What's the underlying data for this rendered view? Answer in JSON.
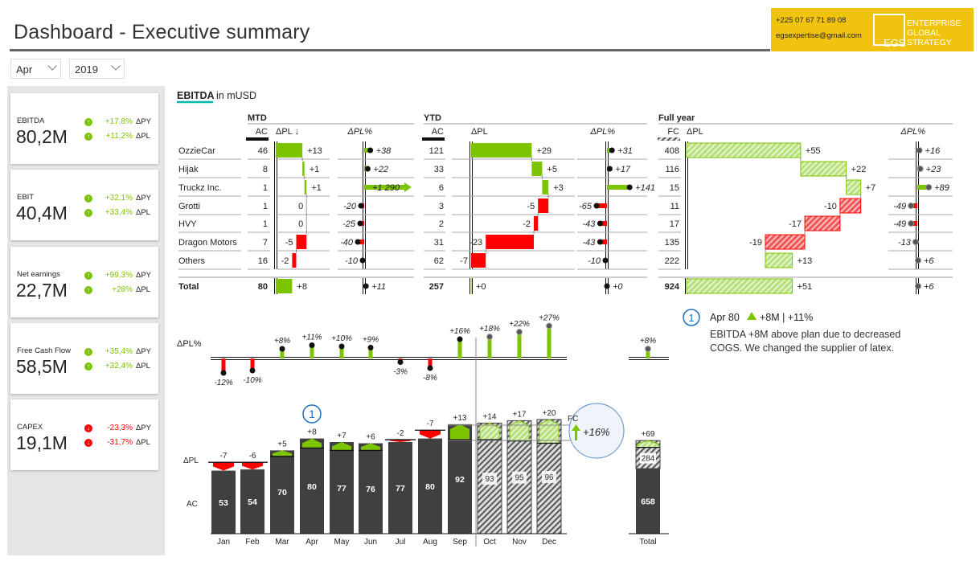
{
  "header": {
    "title": "Dashboard - Executive summary",
    "phone": "+225 07 67 71 89 08",
    "email": "egsexpertise@gmail.com",
    "logo_mark": "EGS",
    "logo_lines": [
      "ENTERPRISE",
      "GLOBAL",
      "STRATEGY"
    ]
  },
  "filters": {
    "month": "Apr",
    "year": "2019"
  },
  "kpis": [
    {
      "title": "EBITDA",
      "value": "80,2M",
      "py": "+17,8%",
      "pl": "+11,2%",
      "py_label": "ΔPY",
      "pl_label": "ΔPL",
      "trend": "up"
    },
    {
      "title": "EBIT",
      "value": "40,4M",
      "py": "+32,1%",
      "pl": "+33,4%",
      "py_label": "ΔPY",
      "pl_label": "ΔPL",
      "trend": "up"
    },
    {
      "title": "Net earnings",
      "value": "22,7M",
      "py": "+99,3%",
      "pl": "+28%",
      "py_label": "ΔPY",
      "pl_label": "ΔPL",
      "trend": "up"
    },
    {
      "title": "Free Cash Flow",
      "value": "58,5M",
      "py": "+35,4%",
      "pl": "+32,4%",
      "py_label": "ΔPY",
      "pl_label": "ΔPL",
      "trend": "up"
    },
    {
      "title": "CAPEX",
      "value": "19,1M",
      "py": "-23,3%",
      "pl": "-31,7%",
      "py_label": "ΔPY",
      "pl_label": "ΔPL",
      "trend": "down"
    }
  ],
  "table": {
    "title": "EBITDA",
    "unit": "in mUSD",
    "sections": {
      "mtd": "MTD",
      "ytd": "YTD",
      "fy": "Full year"
    },
    "headers": {
      "ac": "AC",
      "fc": "FC",
      "dpl": "ΔPL",
      "dpl_sorted": "ΔPL ↓",
      "dplp": "ΔPL%"
    },
    "rows": [
      {
        "name": "OzzieCar",
        "mtd": {
          "ac": "46",
          "dpl": "+13",
          "dplp": "+38"
        },
        "ytd": {
          "ac": "121",
          "dpl": "+29",
          "dplp": "+31"
        },
        "fy": {
          "fc": "408",
          "dpl": "+55",
          "dplp": "+16"
        }
      },
      {
        "name": "Hijak",
        "mtd": {
          "ac": "8",
          "dpl": "+1",
          "dplp": "+22"
        },
        "ytd": {
          "ac": "33",
          "dpl": "+5",
          "dplp": "+17"
        },
        "fy": {
          "fc": "116",
          "dpl": "+22",
          "dplp": "+23"
        }
      },
      {
        "name": "Truckz Inc.",
        "mtd": {
          "ac": "1",
          "dpl": "+1",
          "dplp": "+1 290"
        },
        "ytd": {
          "ac": "6",
          "dpl": "+3",
          "dplp": "+141"
        },
        "fy": {
          "fc": "15",
          "dpl": "+7",
          "dplp": "+89"
        }
      },
      {
        "name": "Grotti",
        "mtd": {
          "ac": "1",
          "dpl": "0",
          "dplp": "-20"
        },
        "ytd": {
          "ac": "3",
          "dpl": "-5",
          "dplp": "-65"
        },
        "fy": {
          "fc": "11",
          "dpl": "-10",
          "dplp": "-49"
        }
      },
      {
        "name": "HVY",
        "mtd": {
          "ac": "1",
          "dpl": "0",
          "dplp": "-25"
        },
        "ytd": {
          "ac": "2",
          "dpl": "-2",
          "dplp": "-43"
        },
        "fy": {
          "fc": "17",
          "dpl": "-17",
          "dplp": "-49"
        }
      },
      {
        "name": "Dragon Motors",
        "mtd": {
          "ac": "7",
          "dpl": "-5",
          "dplp": "-40"
        },
        "ytd": {
          "ac": "31",
          "dpl": "-23",
          "dplp": "-43"
        },
        "fy": {
          "fc": "135",
          "dpl": "-19",
          "dplp": "-13"
        }
      },
      {
        "name": "Others",
        "mtd": {
          "ac": "16",
          "dpl": "-2",
          "dplp": "-10"
        },
        "ytd": {
          "ac": "62",
          "dpl": "-7",
          "dplp": "-10"
        },
        "fy": {
          "fc": "222",
          "dpl": "+13",
          "dplp": "+6"
        }
      }
    ],
    "total": {
      "name": "Total",
      "mtd": {
        "ac": "80",
        "dpl": "+8",
        "dplp": "+11"
      },
      "ytd": {
        "ac": "257",
        "dpl": "+0",
        "dplp": "+0"
      },
      "fy": {
        "fc": "924",
        "dpl": "+51",
        "dplp": "+6"
      }
    }
  },
  "chart_data": {
    "type": "bar",
    "row_labels": {
      "dplp": "ΔPL%",
      "dpl": "ΔPL",
      "ac": "AC"
    },
    "categories": [
      "Jan",
      "Feb",
      "Mar",
      "Apr",
      "May",
      "Jun",
      "Jul",
      "Aug",
      "Sep",
      "Oct",
      "Nov",
      "Dec"
    ],
    "ac": [
      53,
      54,
      70,
      80,
      77,
      76,
      77,
      80,
      92,
      93,
      95,
      96
    ],
    "dpl": [
      "-7",
      "-6",
      "+5",
      "+8",
      "+7",
      "+6",
      "-2",
      "-7",
      "+13",
      "+14",
      "+17",
      "+20"
    ],
    "dplp": [
      "-12%",
      "-10%",
      "+8%",
      "+11%",
      "+10%",
      "+9%",
      "-3%",
      "-8%",
      "+16%",
      "+18%",
      "+22%",
      "+27%"
    ],
    "forecast": [
      false,
      false,
      false,
      false,
      false,
      false,
      false,
      false,
      false,
      true,
      true,
      true
    ],
    "total": {
      "label": "Total",
      "ac": 658,
      "fc": 284,
      "dpl": "+69",
      "dplp": "+8%"
    },
    "fc_compare": {
      "label": "FC",
      "delta": "+16%"
    },
    "annotation_marker": "1",
    "annotation_month": "Apr"
  },
  "comment": {
    "marker": "1",
    "headline_pre": "Apr 80",
    "headline_post": "+8M | +11%",
    "body_lines": [
      "EBITDA +8M above plan due to decreased",
      "COGS. We changed the supplier of latex."
    ]
  },
  "colors": {
    "positive": "#7dc400",
    "negative": "#ff0000",
    "actual": "#404040",
    "accent": "#01b8aa",
    "brand": "#f0c30f",
    "annotation": "#1e6fc0"
  }
}
